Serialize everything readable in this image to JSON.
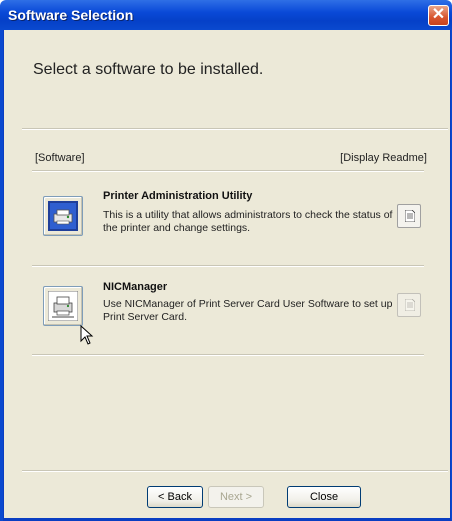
{
  "window": {
    "title": "Software Selection",
    "close_symbol": "✕"
  },
  "heading": "Select a software to be installed.",
  "columns": {
    "left": "[Software]",
    "right": "[Display Readme]"
  },
  "items": [
    {
      "title": "Printer Administration Utility",
      "description": "This is a utility that allows administrators to check the status of the printer and change settings.",
      "icon": "printer-admin-icon"
    },
    {
      "title": "NICManager",
      "description": "Use NICManager of Print Server Card User Software to set up Print Server Card.",
      "icon": "nicmanager-icon"
    }
  ],
  "buttons": {
    "back": "< Back",
    "next": "Next >",
    "close": "Close"
  },
  "colors": {
    "titlebar": "#0a49cf",
    "dialog_bg": "#ece9d8",
    "close_button": "#d8552e"
  }
}
